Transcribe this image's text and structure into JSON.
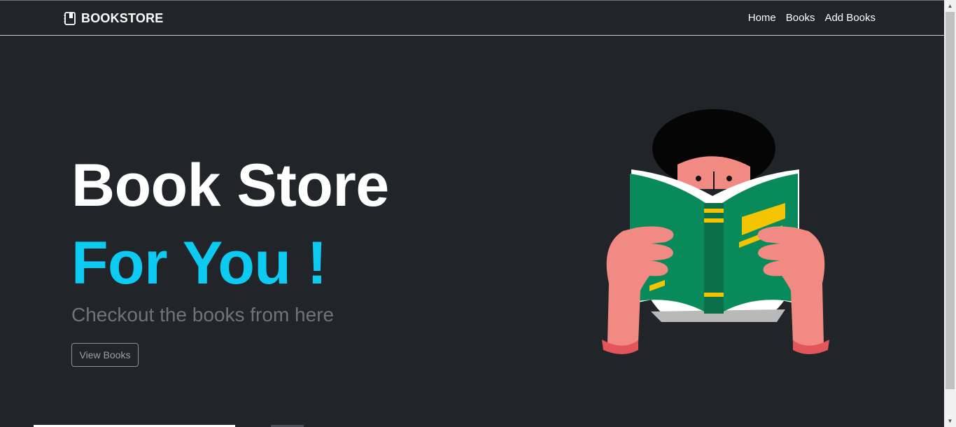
{
  "navbar": {
    "brand": "BOOKSTORE",
    "brand_icon": "book-icon",
    "links": [
      "Home",
      "Books",
      "Add Books"
    ]
  },
  "hero": {
    "title": "Book Store",
    "subtitle": "For You !",
    "tagline": "Checkout the books from here",
    "button_label": "View Books",
    "accent_color": "#0dcaf0",
    "illustration": "person-reading-book-illustration"
  },
  "colors": {
    "background": "#212529",
    "text": "#ffffff",
    "muted": "#6c757d"
  }
}
